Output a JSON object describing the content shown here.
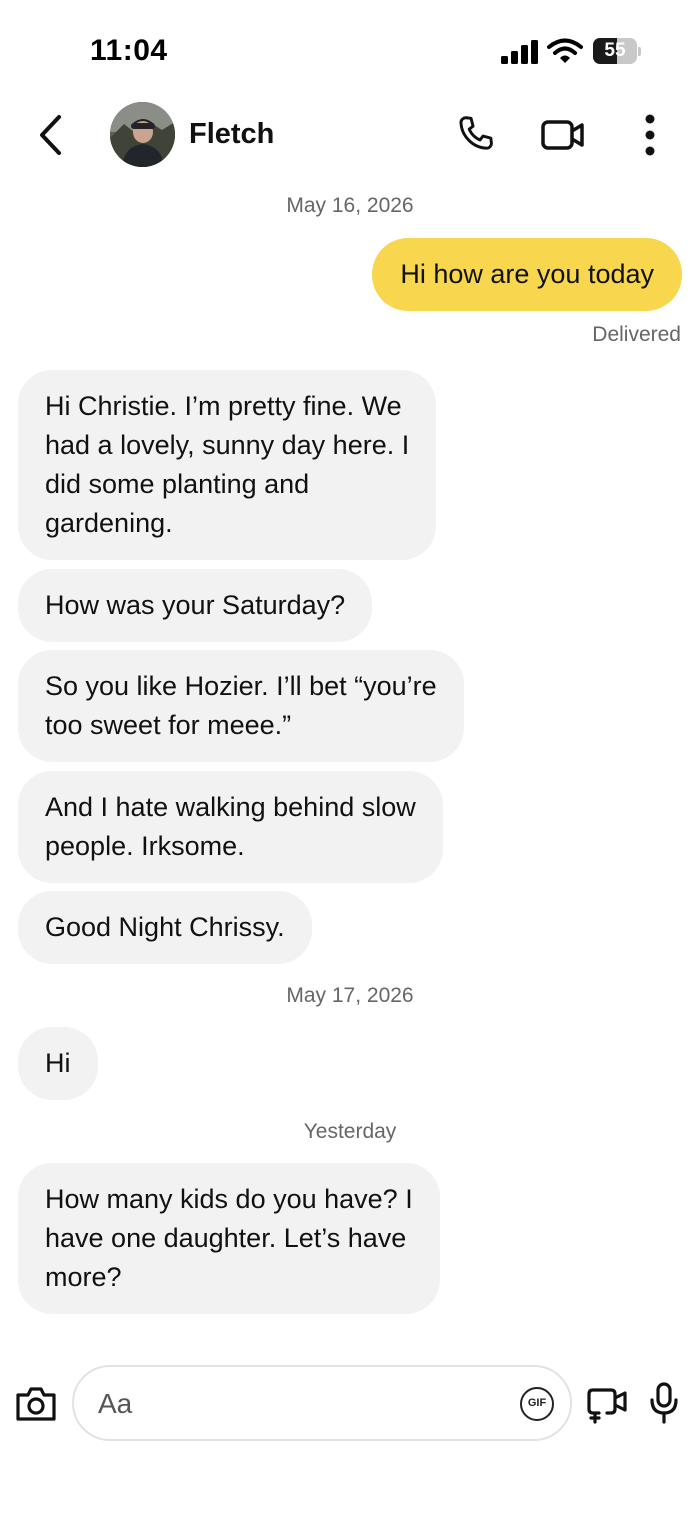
{
  "status_bar": {
    "time": "11:04",
    "battery_level": "55",
    "battery_fraction": 0.55
  },
  "header": {
    "contact_name": "Fletch",
    "icons": [
      "back-arrow-icon",
      "phone-icon",
      "video-camera-icon",
      "more-vertical-icon"
    ]
  },
  "thread": {
    "date_1": "May 16, 2026",
    "outgoing_1": "Hi how are you today",
    "delivered_status": "Delivered",
    "incoming_1": "Hi Christie.  I’m pretty fine.  We\nhad a lovely, sunny day here.  I\ndid some planting and\ngardening.",
    "incoming_2": "How was your Saturday?",
    "incoming_3": "So you like Hozier.  I’ll bet “you’re\ntoo sweet for meee.”",
    "incoming_4": "And I hate walking behind slow\npeople.  Irksome.",
    "incoming_5": "Good Night Chrissy.",
    "date_2": "May 17, 2026",
    "incoming_6": "Hi",
    "date_3": "Yesterday",
    "incoming_7": "How many kids do you have?  I\nhave one daughter.  Let’s have\nmore?"
  },
  "composer": {
    "placeholder": "Aa",
    "gif_label": "GIF",
    "icons": [
      "camera-icon",
      "gif-icon",
      "media-icon",
      "microphone-icon"
    ]
  },
  "colors": {
    "outgoing_bubble": "#f8d74f",
    "incoming_bubble": "#f2f2f2",
    "meta_text": "#666666"
  }
}
